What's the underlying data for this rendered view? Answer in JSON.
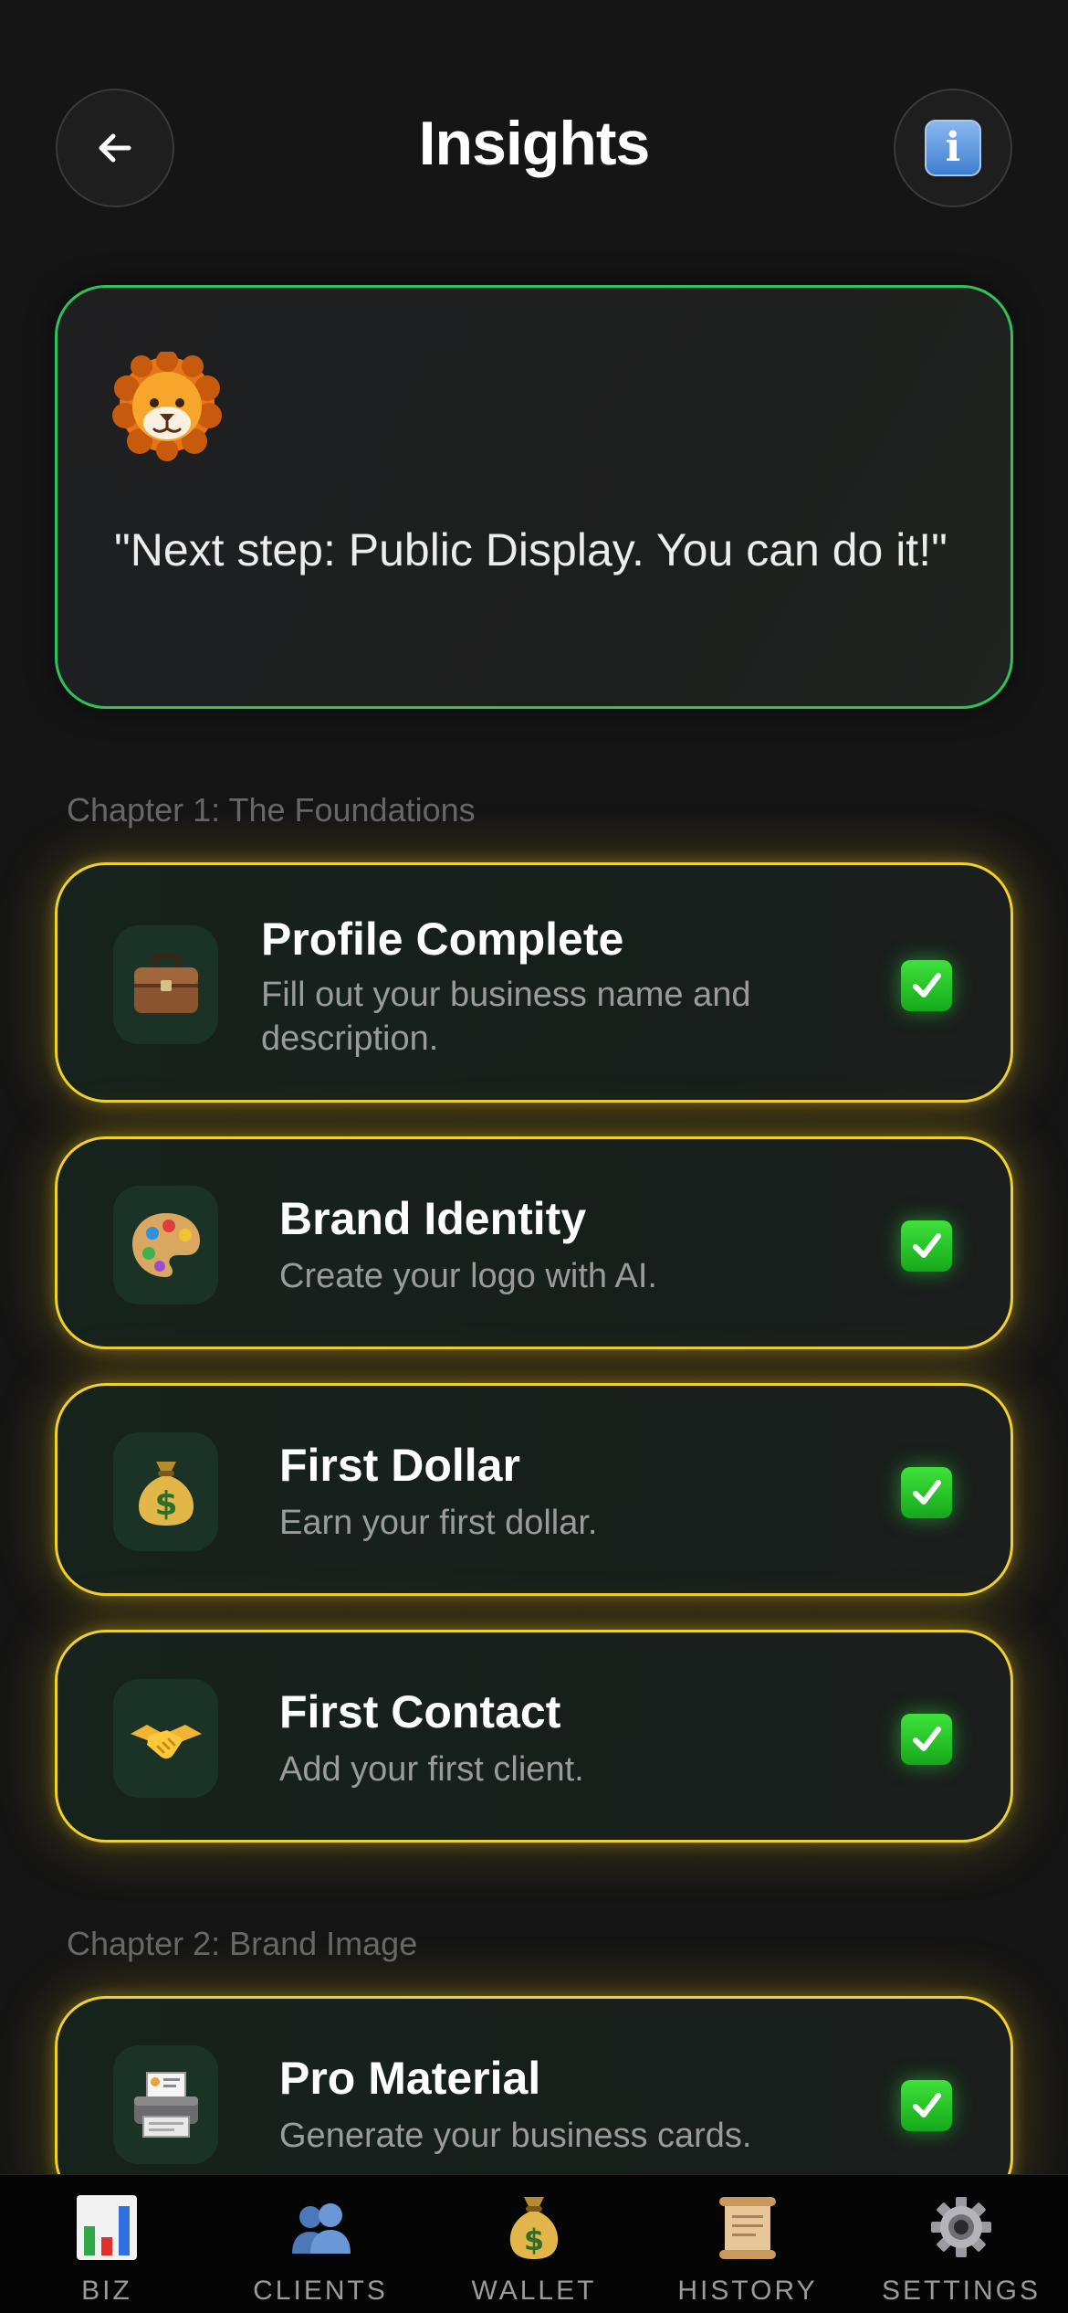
{
  "header": {
    "title": "Insights"
  },
  "mascot": {
    "quote": "\"Next step: Public Display. You can do it!\""
  },
  "chapters": [
    {
      "label": "Chapter 1: The Foundations"
    },
    {
      "label": "Chapter 2: Brand Image"
    }
  ],
  "achievements": [
    {
      "title": "Profile Complete",
      "description": "Fill out your business name and description.",
      "icon": "briefcase-icon",
      "completed": true
    },
    {
      "title": "Brand Identity",
      "description": "Create your logo with AI.",
      "icon": "palette-icon",
      "completed": true
    },
    {
      "title": "First Dollar",
      "description": "Earn your first dollar.",
      "icon": "money-bag-icon",
      "completed": true
    },
    {
      "title": "First Contact",
      "description": "Add your first client.",
      "icon": "handshake-icon",
      "completed": true
    },
    {
      "title": "Pro Material",
      "description": "Generate your business cards.",
      "icon": "printer-icon",
      "completed": true
    }
  ],
  "tabs": [
    {
      "label": "BIZ",
      "icon": "bar-chart-icon"
    },
    {
      "label": "CLIENTS",
      "icon": "people-icon"
    },
    {
      "label": "WALLET",
      "icon": "money-bag-icon"
    },
    {
      "label": "HISTORY",
      "icon": "scroll-icon"
    },
    {
      "label": "SETTINGS",
      "icon": "gear-icon"
    }
  ],
  "colors": {
    "background": "#151515",
    "mascot_border": "#2ec35a",
    "achievement_border": "#f0d12a",
    "check_green": "#22c02a"
  }
}
